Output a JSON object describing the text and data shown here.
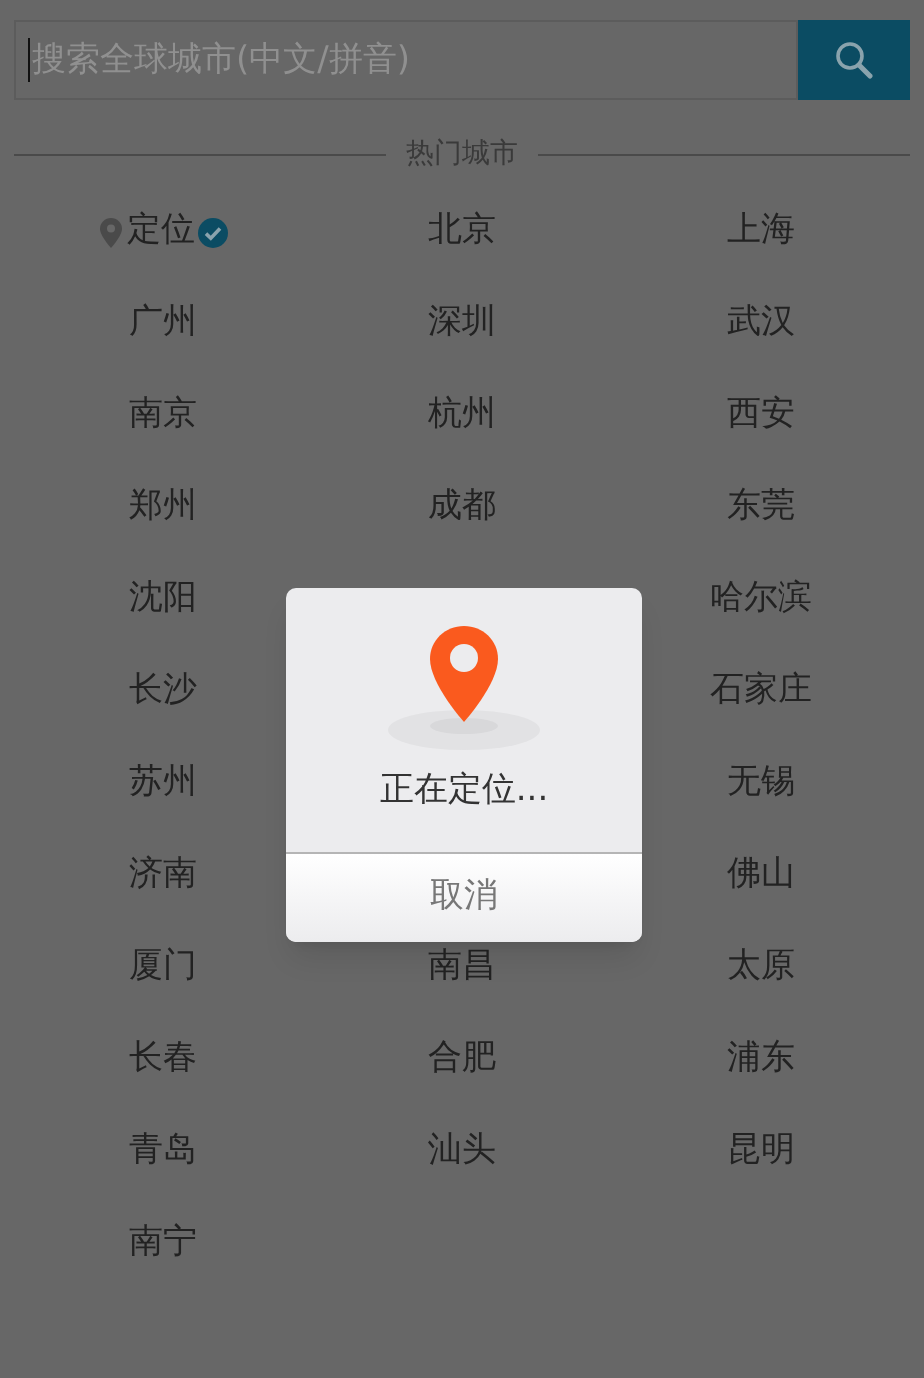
{
  "search": {
    "placeholder": "搜索全球城市(中文/拼音)"
  },
  "section_title": "热门城市",
  "city_rows": [
    [
      {
        "name": "定位",
        "kind": "location",
        "checked": true
      },
      {
        "name": "北京"
      },
      {
        "name": "上海"
      }
    ],
    [
      {
        "name": "广州"
      },
      {
        "name": "深圳"
      },
      {
        "name": "武汉"
      }
    ],
    [
      {
        "name": "南京"
      },
      {
        "name": "杭州"
      },
      {
        "name": "西安"
      }
    ],
    [
      {
        "name": "郑州"
      },
      {
        "name": "成都"
      },
      {
        "name": "东莞"
      }
    ],
    [
      {
        "name": "沈阳"
      },
      null,
      {
        "name": "哈尔滨"
      }
    ],
    [
      {
        "name": "长沙"
      },
      null,
      {
        "name": "石家庄"
      }
    ],
    [
      {
        "name": "苏州"
      },
      null,
      {
        "name": "无锡"
      }
    ],
    [
      {
        "name": "济南"
      },
      null,
      {
        "name": "佛山"
      }
    ],
    [
      {
        "name": "厦门"
      },
      {
        "name": "南昌"
      },
      {
        "name": "太原"
      }
    ],
    [
      {
        "name": "长春"
      },
      {
        "name": "合肥"
      },
      {
        "name": "浦东"
      }
    ],
    [
      {
        "name": "青岛"
      },
      {
        "name": "汕头"
      },
      {
        "name": "昆明"
      }
    ],
    [
      {
        "name": "南宁"
      }
    ]
  ],
  "dialog": {
    "message": "正在定位...",
    "button": "取消"
  }
}
